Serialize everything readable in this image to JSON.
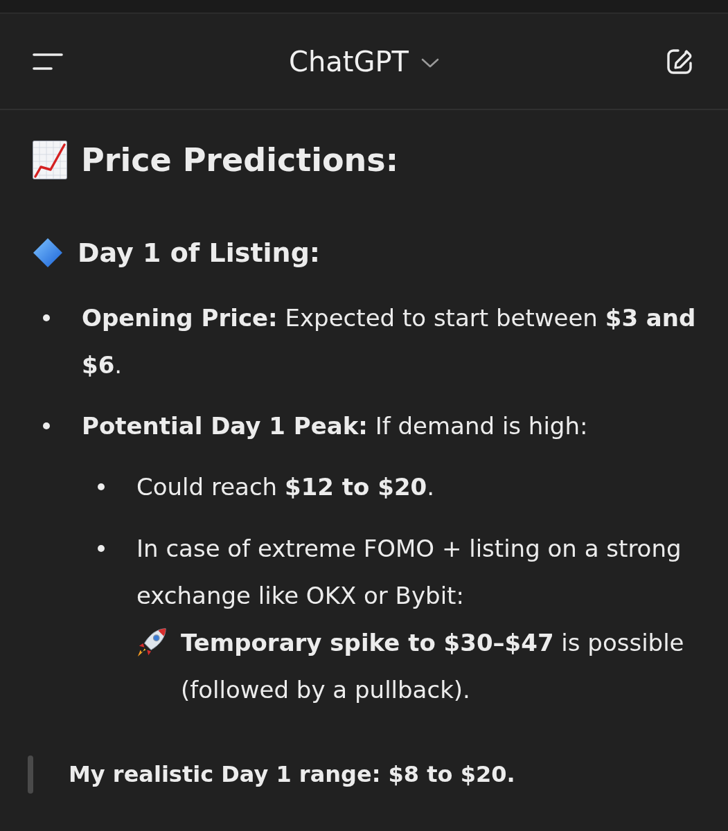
{
  "header": {
    "title": "ChatGPT"
  },
  "message": {
    "heading": "Price Predictions:",
    "section": {
      "title": "Day 1 of Listing:"
    },
    "bullets": [
      {
        "text": "**Opening Price:** Expected to start between **$3 and $6**."
      },
      {
        "text": "**Potential Day 1 Peak:** If demand is high:",
        "children": [
          {
            "text": "Could reach **$12 to $20**."
          },
          {
            "text": "In case of extreme FOMO + listing on a strong exchange like OKX or Bybit:",
            "note": "**Temporary spike to $30–$47** is possible (followed by a pullback)."
          }
        ]
      }
    ],
    "quote": "My realistic Day 1 range: $8 to $20."
  }
}
